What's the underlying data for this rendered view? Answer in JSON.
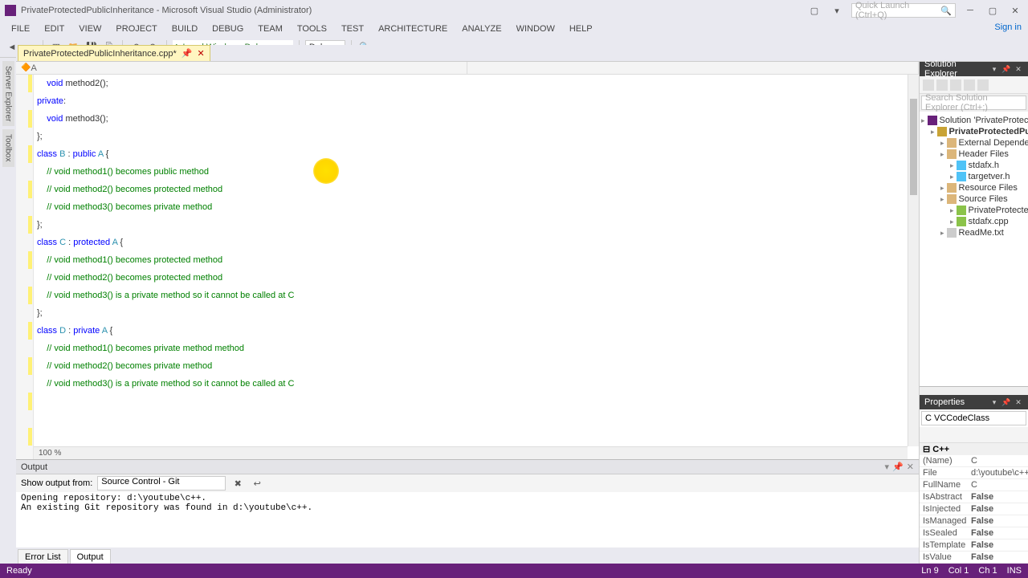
{
  "window": {
    "title": "PrivateProtectedPublicInheritance - Microsoft Visual Studio (Administrator)",
    "quicklaunch_placeholder": "Quick Launch (Ctrl+Q)",
    "signin": "Sign in"
  },
  "menu": [
    "FILE",
    "EDIT",
    "VIEW",
    "PROJECT",
    "BUILD",
    "DEBUG",
    "TEAM",
    "TOOLS",
    "TEST",
    "ARCHITECTURE",
    "ANALYZE",
    "WINDOW",
    "HELP"
  ],
  "toolbar": {
    "debugger": "Local Windows Debugger",
    "config": "Debug"
  },
  "tab": {
    "name": "PrivateProtectedPublicInheritance.cpp*"
  },
  "navdrop": {
    "left": "A",
    "right": ""
  },
  "zoom": "100 %",
  "code_lines": [
    {
      "indent": 1,
      "tokens": [
        {
          "t": "void ",
          "c": "kw"
        },
        {
          "t": "method2();"
        }
      ]
    },
    {
      "indent": 0,
      "tokens": [
        {
          "t": "private",
          "c": "kw"
        },
        {
          "t": ":"
        }
      ]
    },
    {
      "indent": 1,
      "tokens": [
        {
          "t": "void ",
          "c": "kw"
        },
        {
          "t": "method3();"
        }
      ]
    },
    {
      "indent": 0,
      "tokens": [
        {
          "t": "};"
        }
      ]
    },
    {
      "indent": 0,
      "tokens": [
        {
          "t": ""
        }
      ]
    },
    {
      "indent": 0,
      "tokens": [
        {
          "t": "class ",
          "c": "kw"
        },
        {
          "t": "B",
          "c": "typ"
        },
        {
          "t": " : "
        },
        {
          "t": "public ",
          "c": "kw"
        },
        {
          "t": "A",
          "c": "typ"
        },
        {
          "t": " {"
        }
      ]
    },
    {
      "indent": 1,
      "tokens": [
        {
          "t": "// void method1() becomes public method",
          "c": "cm"
        }
      ]
    },
    {
      "indent": 1,
      "tokens": [
        {
          "t": "// void method2() becomes protected method",
          "c": "cm"
        }
      ]
    },
    {
      "indent": 1,
      "tokens": [
        {
          "t": "// void method3() becomes private method",
          "c": "cm"
        }
      ]
    },
    {
      "indent": 0,
      "tokens": [
        {
          "t": "};"
        }
      ]
    },
    {
      "indent": 0,
      "tokens": [
        {
          "t": ""
        }
      ]
    },
    {
      "indent": 0,
      "tokens": [
        {
          "t": "class ",
          "c": "kw"
        },
        {
          "t": "C",
          "c": "typ"
        },
        {
          "t": " : "
        },
        {
          "t": "protected ",
          "c": "kw"
        },
        {
          "t": "A",
          "c": "typ"
        },
        {
          "t": " {"
        }
      ]
    },
    {
      "indent": 1,
      "tokens": [
        {
          "t": "// void method1() becomes protected method",
          "c": "cm"
        }
      ]
    },
    {
      "indent": 1,
      "tokens": [
        {
          "t": "// void method2() becomes protected method",
          "c": "cm"
        }
      ]
    },
    {
      "indent": 1,
      "tokens": [
        {
          "t": "// void method3() is a private method so it cannot be called at C",
          "c": "cm"
        }
      ]
    },
    {
      "indent": 0,
      "tokens": [
        {
          "t": "};"
        }
      ]
    },
    {
      "indent": 0,
      "tokens": [
        {
          "t": ""
        }
      ]
    },
    {
      "indent": 0,
      "tokens": [
        {
          "t": "class ",
          "c": "kw"
        },
        {
          "t": "D",
          "c": "typ"
        },
        {
          "t": " : "
        },
        {
          "t": "private ",
          "c": "kw"
        },
        {
          "t": "A",
          "c": "typ"
        },
        {
          "t": " {"
        }
      ]
    },
    {
      "indent": 1,
      "tokens": [
        {
          "t": "// void method1() becomes private method method",
          "c": "cm"
        }
      ]
    },
    {
      "indent": 1,
      "tokens": [
        {
          "t": "// void method2() becomes private method",
          "c": "cm"
        }
      ]
    },
    {
      "indent": 1,
      "tokens": [
        {
          "t": "// void method3() is a private method so it cannot be called at C",
          "c": "cm"
        }
      ]
    }
  ],
  "solution": {
    "title": "Solution Explorer",
    "search_placeholder": "Search Solution Explorer (Ctrl+;)",
    "items": [
      {
        "lvl": 0,
        "icon": "sln",
        "label": "Solution 'PrivateProtectedPublicInheritance'"
      },
      {
        "lvl": 1,
        "icon": "prj",
        "label": "PrivateProtectedPublicInheritance",
        "bold": true
      },
      {
        "lvl": 2,
        "icon": "fld",
        "label": "External Dependencies"
      },
      {
        "lvl": 2,
        "icon": "fld",
        "label": "Header Files"
      },
      {
        "lvl": 3,
        "icon": "h",
        "label": "stdafx.h"
      },
      {
        "lvl": 3,
        "icon": "h",
        "label": "targetver.h"
      },
      {
        "lvl": 2,
        "icon": "fld",
        "label": "Resource Files"
      },
      {
        "lvl": 2,
        "icon": "fld",
        "label": "Source Files"
      },
      {
        "lvl": 3,
        "icon": "cpp",
        "label": "PrivateProtectedPublicInheritance.cpp"
      },
      {
        "lvl": 3,
        "icon": "cpp",
        "label": "stdafx.cpp"
      },
      {
        "lvl": 2,
        "icon": "txt",
        "label": "ReadMe.txt"
      }
    ]
  },
  "properties": {
    "title": "Properties",
    "object": "C VCCodeClass",
    "category": "C++",
    "rows": [
      {
        "k": "(Name)",
        "v": "C"
      },
      {
        "k": "File",
        "v": "d:\\youtube\\c++\\..."
      },
      {
        "k": "FullName",
        "v": "C"
      },
      {
        "k": "IsAbstract",
        "v": "False"
      },
      {
        "k": "IsInjected",
        "v": "False"
      },
      {
        "k": "IsManaged",
        "v": "False"
      },
      {
        "k": "IsSealed",
        "v": "False"
      },
      {
        "k": "IsTemplate",
        "v": "False"
      },
      {
        "k": "IsValue",
        "v": "False"
      }
    ]
  },
  "output": {
    "title": "Output",
    "from_label": "Show output from:",
    "from_value": "Source Control - Git",
    "body": "Opening repository: d:\\youtube\\c++.\nAn existing Git repository was found in d:\\youtube\\c++.",
    "tabs": [
      "Error List",
      "Output"
    ],
    "active_tab": 1
  },
  "status": {
    "ready": "Ready",
    "ln": "Ln 9",
    "col": "Col 1",
    "ch": "Ch 1",
    "ins": "INS"
  }
}
